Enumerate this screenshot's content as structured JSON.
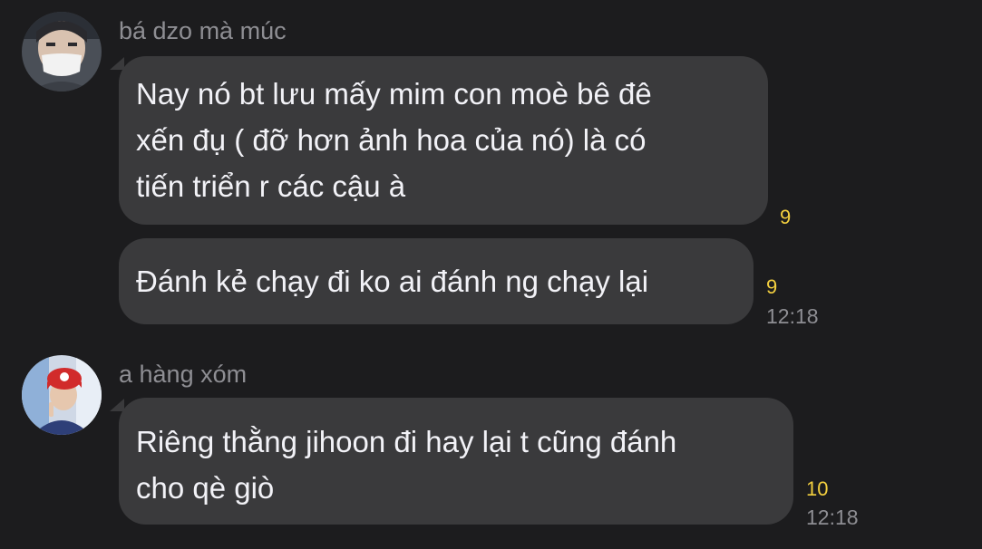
{
  "colors": {
    "background": "#1c1c1e",
    "bubble": "#3a3a3c",
    "text": "#f2f2f7",
    "sender": "#8e8e93",
    "unread_count": "#f4d03f",
    "timestamp": "#8e8e93"
  },
  "groups": [
    {
      "sender": "bá dzo mà múc",
      "avatar_icon": "avatar-masked-person-icon",
      "messages": [
        {
          "lines": [
            "Nay nó bt lưu mấy mim con moè bê đê",
            "xến đụ ( đỡ hơn ảnh hoa của nó) là có",
            "tiến triển r các cậu à"
          ],
          "unread": "9",
          "time": ""
        },
        {
          "lines": [
            "Đánh kẻ chạy đi ko ai đánh ng chạy lại"
          ],
          "unread": "9",
          "time": "12:18"
        }
      ]
    },
    {
      "sender": "a hàng xóm",
      "avatar_icon": "avatar-red-cap-person-icon",
      "messages": [
        {
          "lines": [
            "Riêng thằng jihoon đi hay lại t cũng đánh",
            "cho qè giò"
          ],
          "unread": "10",
          "time": "12:18"
        }
      ]
    }
  ]
}
